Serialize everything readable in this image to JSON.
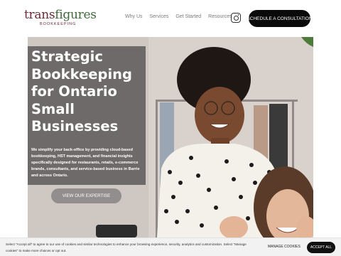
{
  "header": {
    "logo": {
      "main_part1": "trans",
      "main_part2": "figures",
      "sub": "BOOKKEEPING"
    },
    "nav": [
      "Why Us",
      "Services",
      "Get Started",
      "Resources"
    ],
    "social_icon": "instagram-icon",
    "cta_label": "SCHEDULE A CONSULTATION"
  },
  "hero": {
    "title": "Strategic Bookkeeping for Ontario Small Businesses",
    "text": "We simplify your back-office by providing cloud-based bookkeeping, HST management, and financial insights specifically designed for restaurants, retails, e-commerce brands, consultants, and service-based business in Barrie and across Ontario.",
    "button_label": "VIEW OUR EXPERTISE"
  },
  "cookie_bar": {
    "text": "Select \"Accept all\" to agree to our use of cookies and similar technologies to enhance your browsing experience, security, analytics and customization. Select \"Manage cookies\" to make more choices or opt out.",
    "manage_label": "MANAGE COOKIES",
    "accept_label": "ACCEPT ALL"
  },
  "colors": {
    "brand_maroon": "#6b2a3a",
    "brand_green": "#3e6a3a",
    "cta_black": "#0a0a0a"
  }
}
